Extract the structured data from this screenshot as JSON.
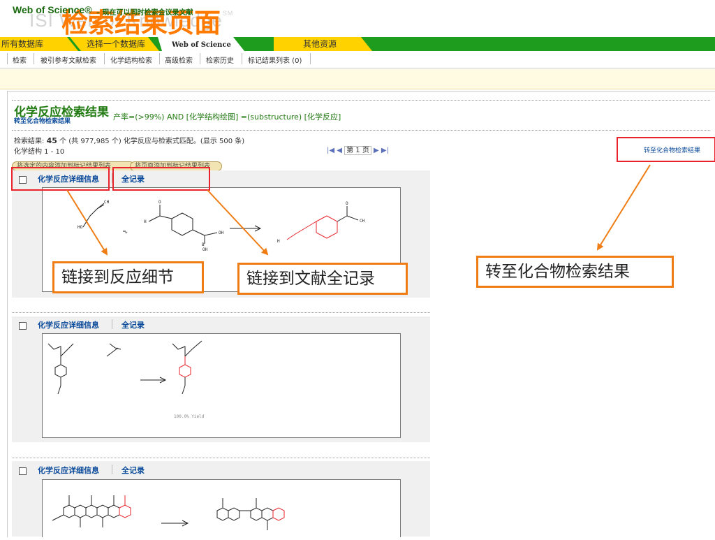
{
  "slide": {
    "title": "检索结果页面",
    "brand_text": "ISI Web of Knowledge",
    "brand_mark": "SM"
  },
  "tabs": [
    {
      "label": "所有数据库"
    },
    {
      "label": "选择一个数据库"
    },
    {
      "label": "Web of Science"
    },
    {
      "label": "其他资源"
    }
  ],
  "subnav": [
    "检索",
    "被引参考文献检索",
    "化学结构检索",
    "高级检索",
    "检索历史",
    "标记结果列表 (0)"
  ],
  "banner": {
    "title": "Web of Science®",
    "subtitle": "– 现在可以同时检索会议录文献"
  },
  "results_header": {
    "title": "化学反应检索结果",
    "compound_link": "转至化合物检索结果",
    "query": "产率=(>99%) AND [化学结构绘图] =(substructure) [化学反应]",
    "count_prefix": "检索结果:",
    "count": "45",
    "count_suffix": "个 (共 977,985 个) 化学反应与检索式匹配。(显示 500 条)",
    "structure_range": "化学结构 1 - 10",
    "pager_prev": "|◀ ◀",
    "pager_page": "第 1 页",
    "pager_next": "▶ ▶|",
    "right_link": "转至化合物检索结果"
  },
  "actions": {
    "add_selected": "将选定的内容添加到标记结果列表",
    "add_page": "将页面添加到标记结果列表"
  },
  "results": [
    {
      "detail_link": "化学反应详细信息",
      "record_link": "全记录",
      "yield_text": ""
    },
    {
      "detail_link": "化学反应详细信息",
      "record_link": "全记录",
      "yield_text": "100.0%\nYield"
    },
    {
      "detail_link": "化学反应详细信息",
      "record_link": "全记录",
      "yield_text": ""
    }
  ],
  "annotations": {
    "reaction_detail": "链接到反应细节",
    "full_record": "链接到文献全记录",
    "compound_results": "转至化合物检索结果"
  },
  "colors": {
    "accent_orange": "#f07d14",
    "highlight_red": "#e8232b",
    "tab_green": "#1e9c1e",
    "tab_yellow": "#ffd200",
    "link_blue": "#0a4a9a",
    "result_green": "#227a12"
  }
}
